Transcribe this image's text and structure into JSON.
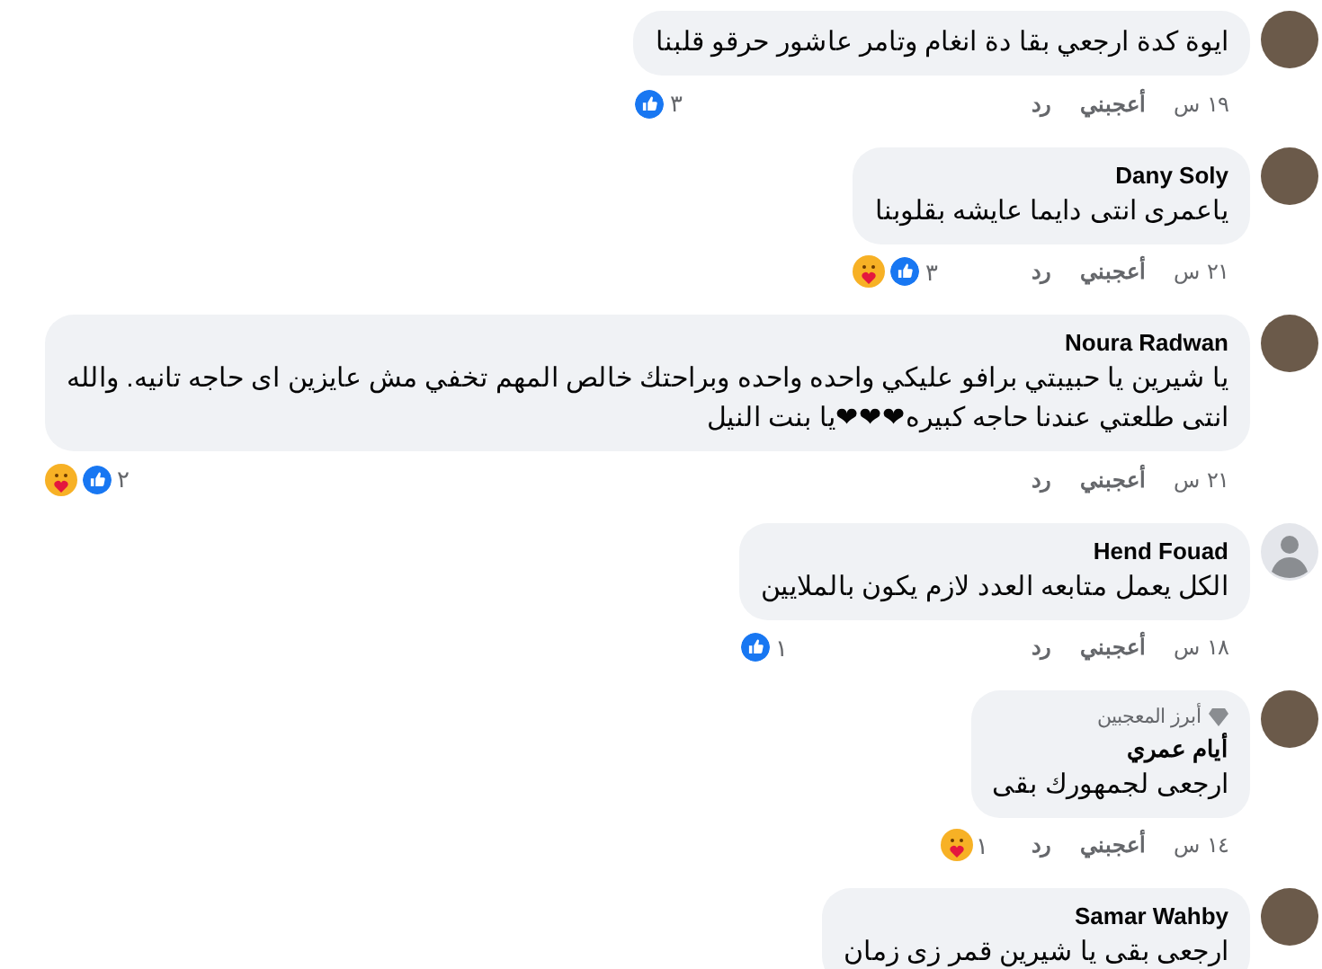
{
  "comments": [
    {
      "default_avatar": false,
      "text": "ايوة كدة ارجعي بقا دة انغام وتامر عاشور حرقو قلبنا",
      "time": "١٩ س",
      "like": "أعجبني",
      "reply": "رد",
      "reactions": [
        {
          "kind": "like"
        }
      ],
      "reaction_count": "٣"
    },
    {
      "default_avatar": false,
      "name": "Dany Soly",
      "text": "ياعمرى انتى دايما عايشه بقلوبنا",
      "time": "٢١ س",
      "like": "أعجبني",
      "reply": "رد",
      "reactions": [
        {
          "kind": "like"
        },
        {
          "kind": "care"
        }
      ],
      "reaction_count": "٣"
    },
    {
      "default_avatar": false,
      "name": "Noura Radwan",
      "text": "يا شيرين يا حبيبتي برافو عليكي واحده واحده وبراحتك خالص المهم تخفي مش عايزين اى حاجه تانيه. والله انتى طلعتي عندنا حاجه كبيره❤❤❤يا بنت النيل",
      "time": "٢١ س",
      "like": "أعجبني",
      "reply": "رد",
      "reactions": [
        {
          "kind": "like"
        },
        {
          "kind": "care"
        }
      ],
      "reaction_count": "٢"
    },
    {
      "default_avatar": true,
      "name": "Hend Fouad",
      "text": "الكل يعمل متابعه العدد لازم يكون بالملايين",
      "time": "١٨ س",
      "like": "أعجبني",
      "reply": "رد",
      "reactions": [
        {
          "kind": "like"
        }
      ],
      "reaction_count": "١"
    },
    {
      "default_avatar": false,
      "badge": "أبرز المعجبين",
      "name": "أيام عمري",
      "text": "ارجعى لجمهورك بقى",
      "time": "١٤ س",
      "like": "أعجبني",
      "reply": "رد",
      "reactions": [
        {
          "kind": "care"
        }
      ],
      "reaction_count": "١"
    },
    {
      "default_avatar": false,
      "name": "Samar Wahby",
      "text": "ارجعى بقى يا شيرين قمر زى زمان"
    }
  ]
}
